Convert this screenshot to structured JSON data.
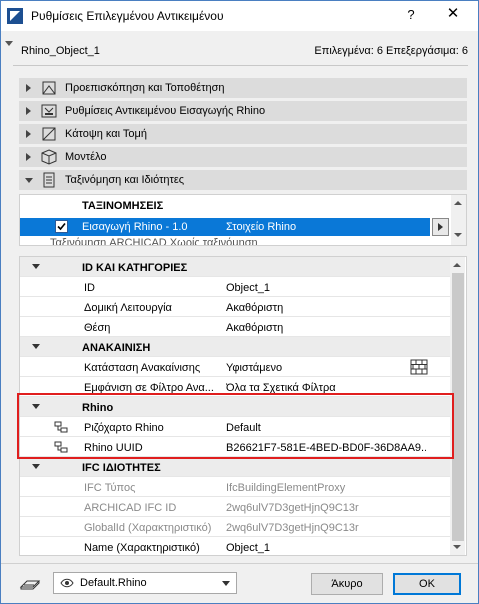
{
  "window": {
    "title": "Ρυθμίσεις Επιλεγμένου Αντικειμένου",
    "help": "?",
    "close": "✕"
  },
  "header": {
    "object_name": "Rhino_Object_1",
    "selection_info": "Επιλεγμένα: 6 Επεξεργάσιμα: 6"
  },
  "sections": [
    {
      "label": "Προεπισκόπηση και Τοποθέτηση",
      "icon": "preview-placement-icon",
      "expanded": false
    },
    {
      "label": "Ρυθμίσεις Αντικειμένου Εισαγωγής Rhino",
      "icon": "rhino-import-settings-icon",
      "expanded": false
    },
    {
      "label": "Κάτοψη και Τομή",
      "icon": "floor-plan-section-icon",
      "expanded": false
    },
    {
      "label": "Μοντέλο",
      "icon": "model-cube-icon",
      "expanded": false
    },
    {
      "label": "Ταξινόμηση και Ιδιότητες",
      "icon": "classification-properties-icon",
      "expanded": true
    }
  ],
  "classifications": {
    "header": "ΤΑΞΙΝΟΜΗΣΕΙΣ",
    "selected_row": {
      "system": "Εισαγωγή Rhino - 1.0",
      "value": "Στοιχείο Rhino",
      "checked": true
    },
    "next_row_partial": "Ταξινόμηση ARCHICAD    Χωρίς ταξινόμηση"
  },
  "properties": {
    "group_id": "ID ΚΑΙ ΚΑΤΗΓΟΡΙΕΣ",
    "id_rows": [
      {
        "name": "ID",
        "value": "Object_1"
      },
      {
        "name": "Δομική Λειτουργία",
        "value": "Ακαθόριστη"
      },
      {
        "name": "Θέση",
        "value": "Ακαθόριστη"
      }
    ],
    "group_renovation": "ΑΝΑΚΑΙΝΙΣΗ",
    "renovation_rows": [
      {
        "name": "Κατάσταση Ανακαίνισης",
        "value": "Υφιστάμενο"
      },
      {
        "name": "Εμφάνιση σε Φίλτρο Ανα...",
        "value": "Όλα τα Σχετικά Φίλτρα"
      }
    ],
    "group_rhino": "Rhino",
    "rhino_rows": [
      {
        "name": "Ριζόχαρτο Rhino",
        "value": "Default"
      },
      {
        "name": "Rhino UUID",
        "value": "B26621F7-581E-4BED-BD0F-36D8AA9..."
      }
    ],
    "group_ifc": "IFC ΙΔΙΟΤΗΤΕΣ",
    "ifc_rows": [
      {
        "name": "IFC Τύπος",
        "value": "IfcBuildingElementProxy",
        "dim": true
      },
      {
        "name": "ARCHICAD IFC ID",
        "value": "2wq6ulV7D3getHjnQ9C13r",
        "dim": true
      },
      {
        "name": "GlobalId (Χαρακτηριστικό)",
        "value": "2wq6ulV7D3getHjnQ9C13r",
        "dim": true
      },
      {
        "name": "Name (Χαρακτηριστικό)",
        "value": "Object_1",
        "dim": false
      }
    ]
  },
  "footer": {
    "favorite": "Default.Rhino",
    "cancel": "Άκυρο",
    "ok": "OK"
  },
  "colors": {
    "selection": "#0a78d7",
    "highlight_box": "#e01e1e"
  }
}
